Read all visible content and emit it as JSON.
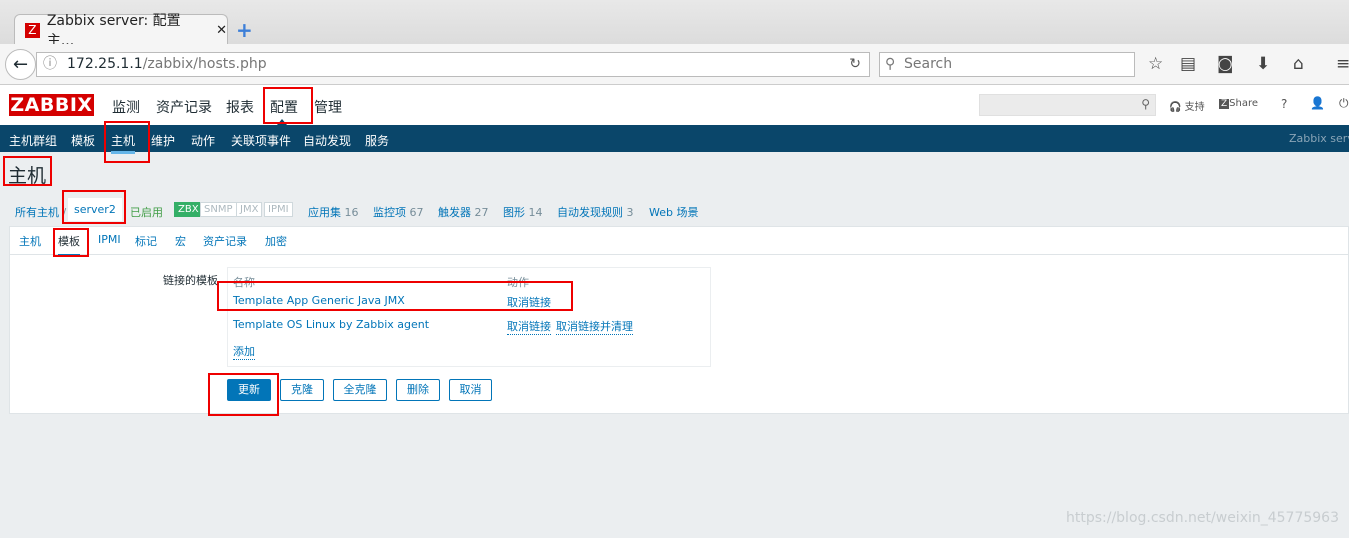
{
  "browser": {
    "tab_title": "Zabbix server: 配置主...",
    "url_host": "172.25.1.1",
    "url_path": "/zabbix/hosts.php",
    "search_placeholder": "Search"
  },
  "header": {
    "logo": "ZABBIX",
    "menu": [
      "监测",
      "资产记录",
      "报表",
      "配置",
      "管理"
    ],
    "support": "支持",
    "share": "Share",
    "help": "?"
  },
  "submenu": {
    "items": [
      "主机群组",
      "模板",
      "主机",
      "维护",
      "动作",
      "关联项事件",
      "自动发现",
      "服务"
    ],
    "server": "Zabbix server"
  },
  "page": {
    "title": "主机"
  },
  "hostnav": {
    "all_hosts": "所有主机",
    "sep": "/",
    "host": "server2",
    "status": "已启用",
    "badges": [
      "ZBX",
      "SNMP",
      "JMX",
      "IPMI"
    ],
    "links": [
      {
        "label": "应用集",
        "count": "16"
      },
      {
        "label": "监控项",
        "count": "67"
      },
      {
        "label": "触发器",
        "count": "27"
      },
      {
        "label": "图形",
        "count": "14"
      },
      {
        "label": "自动发现规则",
        "count": "3"
      },
      {
        "label": "Web 场景",
        "count": ""
      }
    ]
  },
  "tabs": [
    "主机",
    "模板",
    "IPMI",
    "标记",
    "宏",
    "资产记录",
    "加密"
  ],
  "templates": {
    "label": "链接的模板",
    "col_name": "名称",
    "col_action": "动作",
    "rows": [
      {
        "name": "Template App Generic Java JMX",
        "unlink": "取消链接",
        "clear": ""
      },
      {
        "name": "Template OS Linux by Zabbix agent",
        "unlink": "取消链接",
        "clear": "取消链接并清理"
      }
    ],
    "add": "添加"
  },
  "buttons": {
    "update": "更新",
    "clone": "克隆",
    "full_clone": "全克隆",
    "delete": "删除",
    "cancel": "取消"
  },
  "watermark": "https://blog.csdn.net/weixin_45775963",
  "colors": {
    "brand": "#d40000",
    "nav": "#0a466a",
    "link": "#0275b8",
    "zbx_badge": "#34af67"
  }
}
